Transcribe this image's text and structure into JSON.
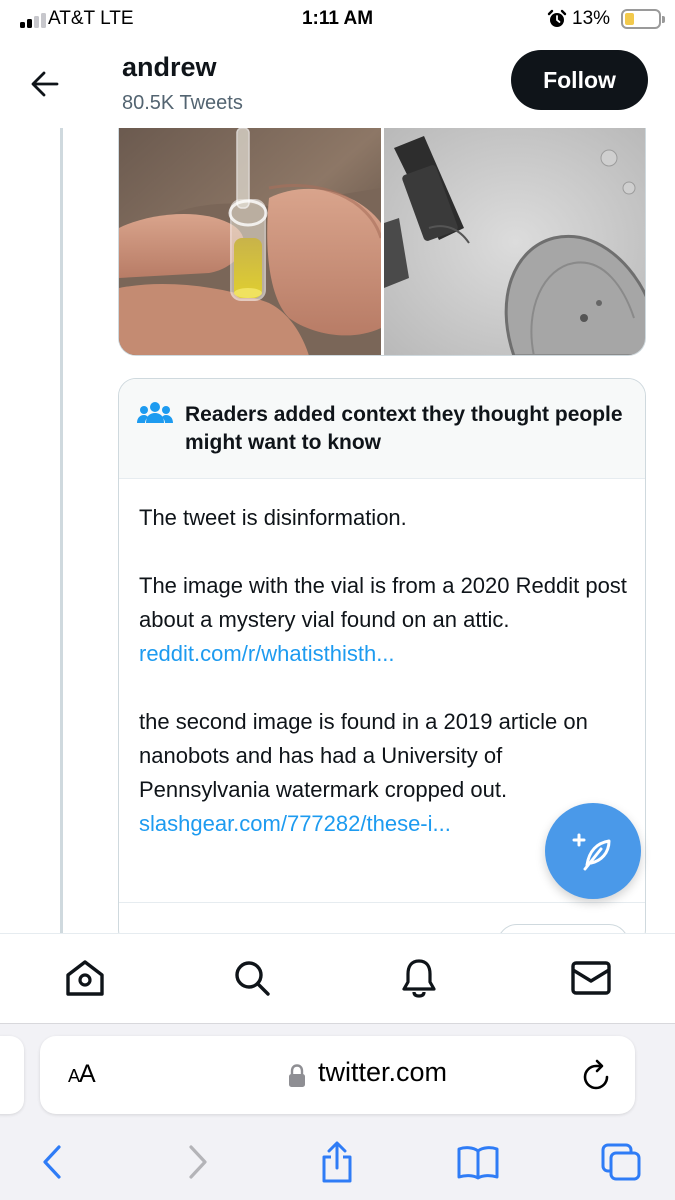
{
  "status_bar": {
    "carrier": "AT&T  LTE",
    "time": "1:11 AM",
    "battery_percent": "13%",
    "battery_level": 0.13,
    "battery_color": "#f2c94c",
    "signal_bars": 2,
    "signal_bars_total": 4,
    "icons": [
      "signal-icon",
      "alarm-icon",
      "battery-icon"
    ]
  },
  "profile_header": {
    "back_icon": "arrow-left-icon",
    "name": "andrew",
    "tweet_count": "80.5K Tweets",
    "follow_label": "Follow"
  },
  "tweet": {
    "media": [
      {
        "name": "vial-photo",
        "description_visible": false
      },
      {
        "name": "microscope-photo",
        "description_visible": false
      }
    ],
    "community_note": {
      "icon": "people-icon",
      "title": "Readers added context they thought people might want to know",
      "paragraph_1": "The tweet is disinformation.",
      "paragraph_2_text": "The image with the vial is from a 2020 Reddit post about a mystery vial found on an attic. ",
      "paragraph_2_link": "reddit.com/r/whatisthisth...",
      "paragraph_3_text": "the second image is found in a 2019 article on nanobots and has had a University of Pennsylvania watermark cropped out. ",
      "paragraph_3_link": "slashgear.com/777282/these-i..."
    },
    "compose_icon": "compose-feather-icon"
  },
  "tab_bar": {
    "items": [
      "home-icon",
      "search-icon",
      "notifications-bell-icon",
      "messages-envelope-icon"
    ]
  },
  "safari": {
    "text_size_label_big": "A",
    "text_size_label_small": "A",
    "url": "twitter.com",
    "toolbar": [
      "back-chevron-icon",
      "forward-chevron-icon",
      "share-icon",
      "bookmarks-book-icon",
      "tabs-icon"
    ]
  },
  "colors": {
    "accent": "#1d9bf0",
    "follow_button": "#0f1419",
    "fab": "#4a99e9",
    "safari_blue": "#2f7cf6",
    "muted_text": "#536471"
  }
}
